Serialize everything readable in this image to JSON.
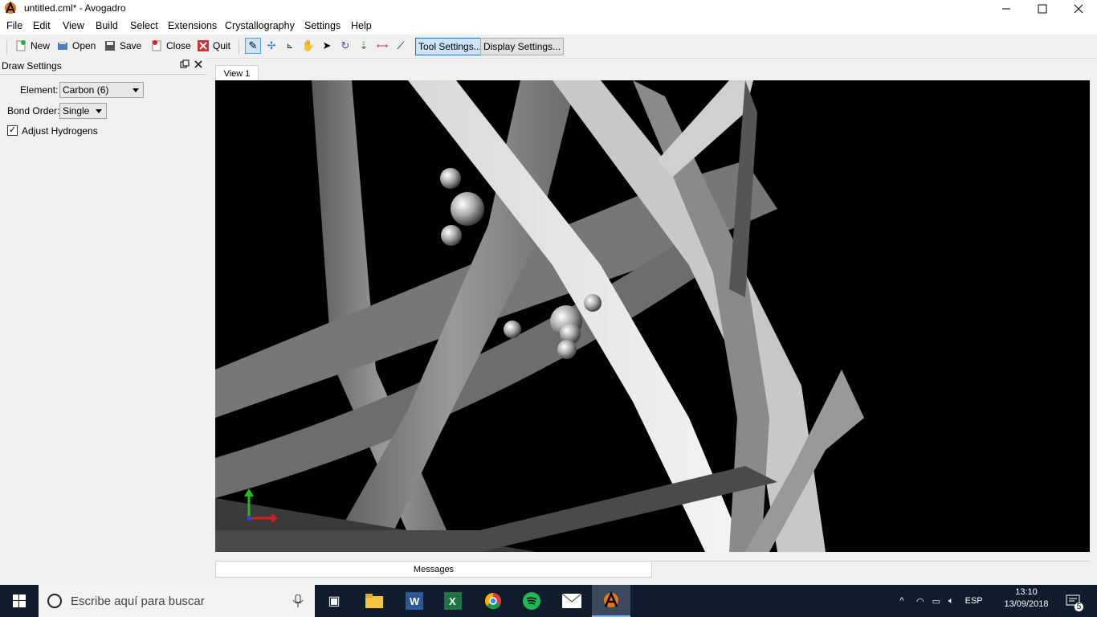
{
  "window": {
    "title": "untitled.cml* - Avogadro"
  },
  "menu": [
    "File",
    "Edit",
    "View",
    "Build",
    "Select",
    "Extensions",
    "Crystallography",
    "Settings",
    "Help"
  ],
  "toolbar": {
    "new_label": "New",
    "open_label": "Open",
    "save_label": "Save",
    "close_label": "Close",
    "quit_label": "Quit",
    "tool_settings": "Tool Settings...",
    "display_settings": "Display Settings..."
  },
  "panel": {
    "title": "Draw Settings",
    "element_label": "Element:",
    "element_value": "Carbon (6)",
    "bond_order_label": "Bond Order:",
    "bond_order_value": "Single",
    "adjust_hydrogens_label": "Adjust Hydrogens",
    "adjust_hydrogens_checked": true
  },
  "view_tab": "View 1",
  "messages_tab": "Messages",
  "taskbar": {
    "search_placeholder": "Escribe aquí para buscar",
    "language": "ESP",
    "time": "13:10",
    "date": "13/09/2018",
    "notification_count": "5"
  }
}
